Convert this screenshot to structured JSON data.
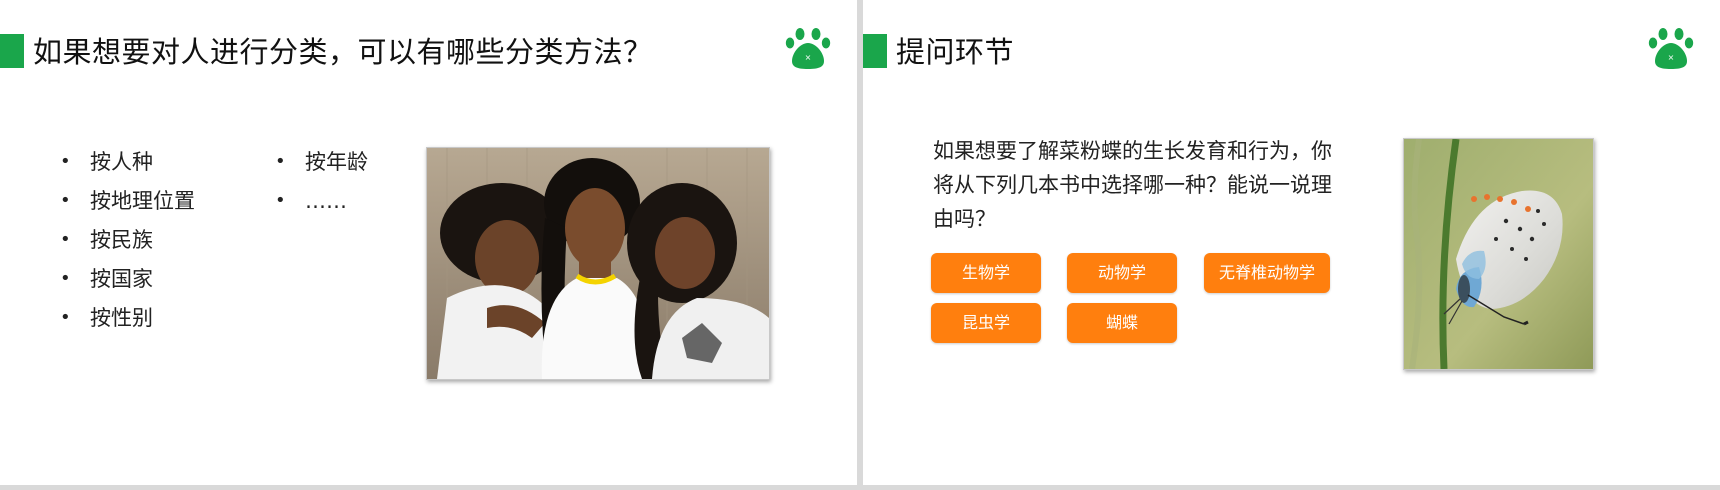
{
  "left_slide": {
    "title": "如果想要对人进行分类，可以有哪些分类方法？",
    "column_1": [
      "按人种",
      "按地理位置",
      "按民族",
      "按国家",
      "按性别"
    ],
    "column_2": [
      "按年龄",
      "……"
    ],
    "logo_icon": "paw-print-icon",
    "image": "photo-of-three-women"
  },
  "right_slide": {
    "title": "提问环节",
    "question": "如果想要了解菜粉蝶的生长发育和行为，你将从下列几本书中选择哪一种？能说一说理由吗？",
    "options": [
      "生物学",
      "动物学",
      "无脊椎动物学",
      "昆虫学",
      "蝴蝶"
    ],
    "logo_icon": "paw-print-icon",
    "image": "photo-of-blue-butterfly"
  },
  "colors": {
    "accent_green": "#1aa64b",
    "button_orange": "#ff7f0e",
    "background": "#ffffff",
    "divider": "#d9d9d9"
  }
}
